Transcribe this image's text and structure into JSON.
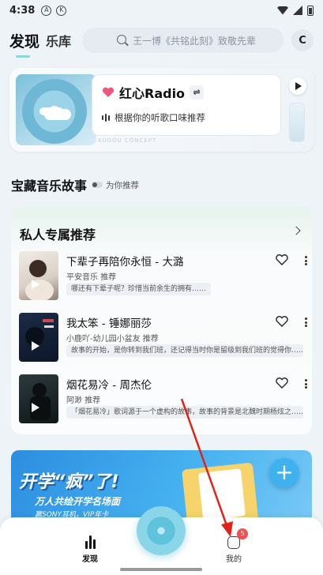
{
  "status_bar": {
    "time": "4:38",
    "icon_a": "A",
    "icon_k": "K"
  },
  "header": {
    "tab_discover": "发现",
    "tab_library": "乐库",
    "search_placeholder": "王一博《共铭此刻》致敬先辈",
    "mic_label": "C"
  },
  "radio": {
    "title": "红心Radio",
    "subtitle": "根据你的听歌口味推荐",
    "concept": "KUGOU CONCEPT",
    "accent": "#f2557a"
  },
  "section": {
    "title": "宝藏音乐故事",
    "hint": "为你推荐"
  },
  "recommend": {
    "title": "私人专属推荐",
    "songs": [
      {
        "title": "下辈子再陪你永恒 - 大潞",
        "sub": "平安音乐 推荐",
        "desc": "哪还有下辈子呢？珍惜当前余生的拥有……"
      },
      {
        "title": "我太笨 - 锤娜丽莎",
        "sub": "小鹿吖-幼儿园小盆友 推荐",
        "desc": "故事的开始，是你转到我们班，还记得当时你是留级到我们班的觉得你……"
      },
      {
        "title": "烟花易冷 - 周杰伦",
        "sub": "阿渺 推荐",
        "desc": "「烟花易冷」歌词源于一个虚构的故事，故事的背景是北魏时期杨炫之……"
      }
    ]
  },
  "banner": {
    "headline": "开学“疯”了!",
    "line2": "万人共绘开学名场面",
    "line3": "赢SONY耳机，VIP年卡"
  },
  "nav": {
    "discover": "发现",
    "me": "我的",
    "badge": "5"
  }
}
